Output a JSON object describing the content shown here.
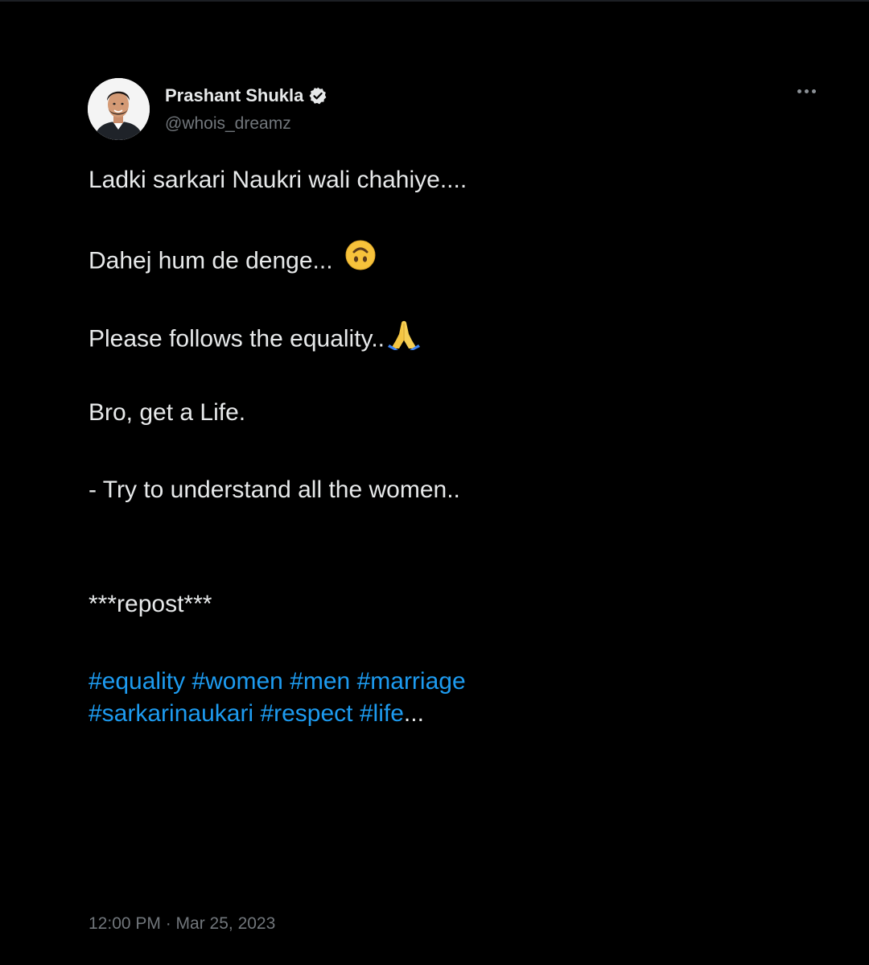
{
  "author": {
    "display_name": "Prashant Shukla",
    "handle": "@whois_dreamz",
    "verified": true,
    "verified_icon": "verified-badge-icon",
    "avatar_icon": "profile-avatar"
  },
  "menu": {
    "icon": "more-options-icon"
  },
  "tweet": {
    "lines": [
      "Ladki sarkari Naukri wali chahiye....",
      "Dahej hum de denge...",
      "Please follows the equality..",
      "Bro, get a Life.",
      "- Try to understand all the women..",
      "***repost***"
    ],
    "emojis": {
      "line2": "upside-down-face-emoji",
      "line3": "folded-hands-emoji"
    },
    "hashtags_row1": [
      "#equality",
      "#women",
      "#men",
      "#marriage"
    ],
    "hashtags_row2": [
      "#sarkarinaukari",
      "#respect",
      "#life"
    ],
    "truncation": "..."
  },
  "meta": {
    "timestamp": "12:00 PM · Mar 25, 2023"
  },
  "colors": {
    "background": "#000000",
    "text": "#e7e9ea",
    "muted": "#71767b",
    "link": "#1d9bf0",
    "verified": "#e7e9ea"
  }
}
